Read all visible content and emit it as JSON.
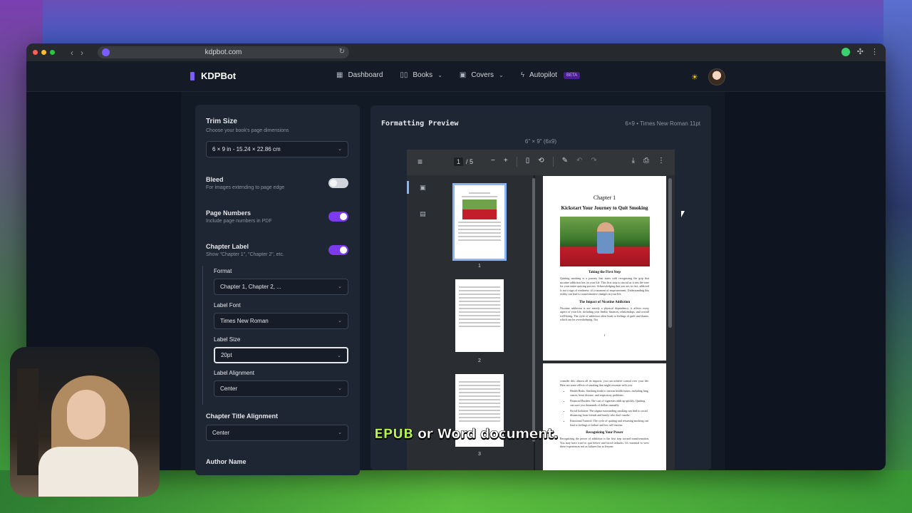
{
  "browser": {
    "url": "kdpbot.com"
  },
  "app": {
    "brand": "KDPBot",
    "nav": {
      "dashboard": "Dashboard",
      "books": "Books",
      "covers": "Covers",
      "autopilot": "Autopilot",
      "beta": "BETA"
    }
  },
  "settings": {
    "trim_size": {
      "label": "Trim Size",
      "sub": "Choose your book's page dimensions",
      "value": "6 × 9 in - 15.24 × 22.86 cm"
    },
    "bleed": {
      "label": "Bleed",
      "sub": "For images extending to page edge",
      "enabled": false
    },
    "page_numbers": {
      "label": "Page Numbers",
      "sub": "Include page numbers in PDF",
      "enabled": true
    },
    "chapter_label": {
      "label": "Chapter Label",
      "sub": "Show \"Chapter 1\", \"Chapter 2\", etc.",
      "enabled": true,
      "format_label": "Format",
      "format_value": "Chapter 1, Chapter 2, ...",
      "font_label": "Label Font",
      "font_value": "Times New Roman",
      "size_label": "Label Size",
      "size_value": "20pt",
      "align_label": "Label Alignment",
      "align_value": "Center"
    },
    "chapter_title_alignment": {
      "label": "Chapter Title Alignment",
      "value": "Center"
    },
    "author_name": {
      "label": "Author Name"
    }
  },
  "preview": {
    "title": "Formatting Preview",
    "meta": "6×9 • Times New Roman 11pt",
    "size_caption": "6\" × 9\" (6x9)",
    "viewer": {
      "current_page": "1",
      "total_pages": "/ 5",
      "thumb_numbers": [
        "1",
        "2",
        "3"
      ]
    },
    "page": {
      "chapter": "Chapter 1",
      "heading": "Kickstart Your Journey to Quit Smoking",
      "section1": "Taking the First Step",
      "para1": "Quitting smoking is a journey that starts with recognizing the grip that nicotine addiction has on your life. This first step is crucial as it sets the tone for your entire quitting process. Acknowledging that you are, in fact, addicted is not a sign of weakness; it's a moment of empowerment. Understanding this reality can lead to transformative changes in your life.",
      "section2": "The Impact of Nicotine Addiction",
      "para2": "Nicotine addiction is not merely a physical dependency; it affects every aspect of your life, including your health, finances, relationships, and overall well-being. The cycle of addiction often leads to feelings of guilt and shame, which can be overwhelming. Not",
      "page_no": "1",
      "page2_intro": "consider this: almost all its impacts, you can achieve control over your life. Here are some effects of smoking that might resonate with you:",
      "bullets": [
        "Health Risks: Smoking leads to various health issues, including lung cancer, heart disease, and respiratory problems.",
        "Financial Burden: The cost of cigarettes adds up quickly. Quitting can save you thousands of dollars annually.",
        "Social Isolation: The stigma surrounding smoking can lead to social distancing from friends and family who don't smoke.",
        "Emotional Turmoil: The cycle of quitting and resuming smoking can lead to feelings of failure and low self-esteem."
      ],
      "section3": "Recognizing Your Power",
      "para3": "Recognizing the power of addiction is the first step toward transformation. You may have tried to quit before and faced setbacks. It's essential to view these experiences not as failures but as lessons"
    }
  },
  "caption": {
    "highlight": "EPUB",
    "rest": " or Word document."
  }
}
